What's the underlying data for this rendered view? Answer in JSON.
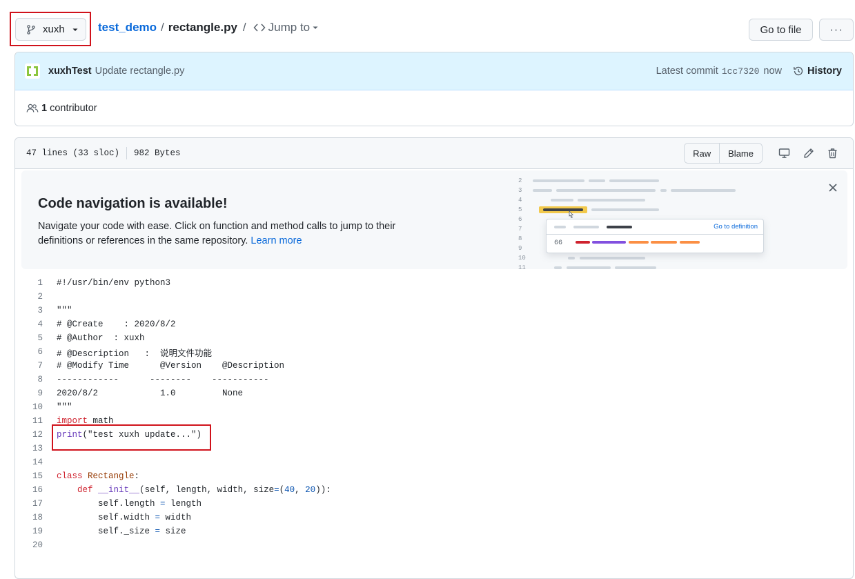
{
  "branch": {
    "name": "xuxh"
  },
  "breadcrumb": {
    "repo": "test_demo",
    "separator": "/",
    "file": "rectangle.py",
    "jump_to": "Jump to"
  },
  "actions": {
    "go_to_file": "Go to file",
    "more": "···"
  },
  "commit": {
    "author": "xuxhTest",
    "message": "Update rectangle.py",
    "latest_label": "Latest commit",
    "sha": "1cc7320",
    "time": "now",
    "history_label": "History"
  },
  "contributors": {
    "count": "1",
    "label": "contributor"
  },
  "file_info": {
    "lines": "47 lines (33 sloc)",
    "size": "982 Bytes",
    "raw": "Raw",
    "blame": "Blame"
  },
  "banner": {
    "title": "Code navigation is available!",
    "description": "Navigate your code with ease. Click on function and method calls to jump to their definitions or references in the same repository.",
    "link": "Learn more",
    "illustration": {
      "line_numbers": [
        "2",
        "3",
        "4",
        "5",
        "6",
        "7",
        "8",
        "9",
        "10",
        "11"
      ],
      "popup_link": "Go to definition",
      "popup_number": "66"
    }
  },
  "code_lines": [
    {
      "n": "1",
      "text": "#!/usr/bin/env python3"
    },
    {
      "n": "2",
      "text": ""
    },
    {
      "n": "3",
      "text": "\"\"\""
    },
    {
      "n": "4",
      "text": "# @Create    : 2020/8/2"
    },
    {
      "n": "5",
      "text": "# @Author  : xuxh"
    },
    {
      "n": "6",
      "text": "# @Description   :  说明文件功能"
    },
    {
      "n": "7",
      "text": "# @Modify Time      @Version    @Description"
    },
    {
      "n": "8",
      "text": "------------      --------    -----------"
    },
    {
      "n": "9",
      "text": "2020/8/2            1.0         None"
    },
    {
      "n": "10",
      "text": "\"\"\""
    },
    {
      "n": "11",
      "text": "import math"
    },
    {
      "n": "12",
      "text": "print(\"test xuxh update...\")"
    },
    {
      "n": "13",
      "text": ""
    },
    {
      "n": "14",
      "text": ""
    },
    {
      "n": "15",
      "text": "class Rectangle:"
    },
    {
      "n": "16",
      "text": "    def __init__(self, length, width, size=(40, 20)):"
    },
    {
      "n": "17",
      "text": "        self.length = length"
    },
    {
      "n": "18",
      "text": "        self.width = width"
    },
    {
      "n": "19",
      "text": "        self._size = size"
    },
    {
      "n": "20",
      "text": ""
    }
  ],
  "colors": {
    "accent": "#0969da",
    "highlight_box": "#d0121b",
    "commit_bg": "#ddf4ff",
    "keyword": "#cf222e",
    "function": "#6639ba"
  }
}
